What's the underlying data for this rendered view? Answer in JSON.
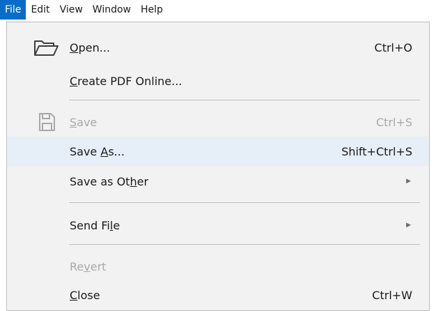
{
  "menubar": {
    "items": [
      {
        "label": "File",
        "active": true
      },
      {
        "label": "Edit"
      },
      {
        "label": "View"
      },
      {
        "label": "Window"
      },
      {
        "label": "Help"
      }
    ]
  },
  "file_menu": {
    "items": [
      {
        "label_pre": "",
        "mnemonic": "O",
        "label_post": "pen...",
        "shortcut": "Ctrl+O",
        "icon": "folder-open-icon",
        "disabled": false,
        "hovered": false
      },
      {
        "label_pre": "",
        "mnemonic": "C",
        "label_post": "reate PDF Online...",
        "shortcut": "",
        "disabled": false,
        "hovered": false
      },
      {
        "label_pre": "",
        "mnemonic": "S",
        "label_post": "ave",
        "shortcut": "Ctrl+S",
        "icon": "save-icon",
        "disabled": true,
        "hovered": false
      },
      {
        "label_pre": "Save ",
        "mnemonic": "A",
        "label_post": "s...",
        "shortcut": "Shift+Ctrl+S",
        "disabled": false,
        "hovered": true
      },
      {
        "label_pre": "Save as Ot",
        "mnemonic": "h",
        "label_post": "er",
        "shortcut": "",
        "submenu": true,
        "disabled": false,
        "hovered": false
      },
      {
        "label_pre": "Send Fi",
        "mnemonic": "l",
        "label_post": "e",
        "shortcut": "",
        "submenu": true,
        "disabled": false,
        "hovered": false
      },
      {
        "label_pre": "Re",
        "mnemonic": "v",
        "label_post": "ert",
        "shortcut": "",
        "disabled": true,
        "hovered": false
      },
      {
        "label_pre": "",
        "mnemonic": "C",
        "label_post": "lose",
        "shortcut": "Ctrl+W",
        "disabled": false,
        "hovered": false
      }
    ],
    "submenu_glyph": "▶",
    "colors": {
      "active_menu_bg": "#0a6cc9",
      "hover_bg": "#e6eef8",
      "menu_bg": "#f2f2f2",
      "disabled_text": "#a8a8a8"
    }
  }
}
